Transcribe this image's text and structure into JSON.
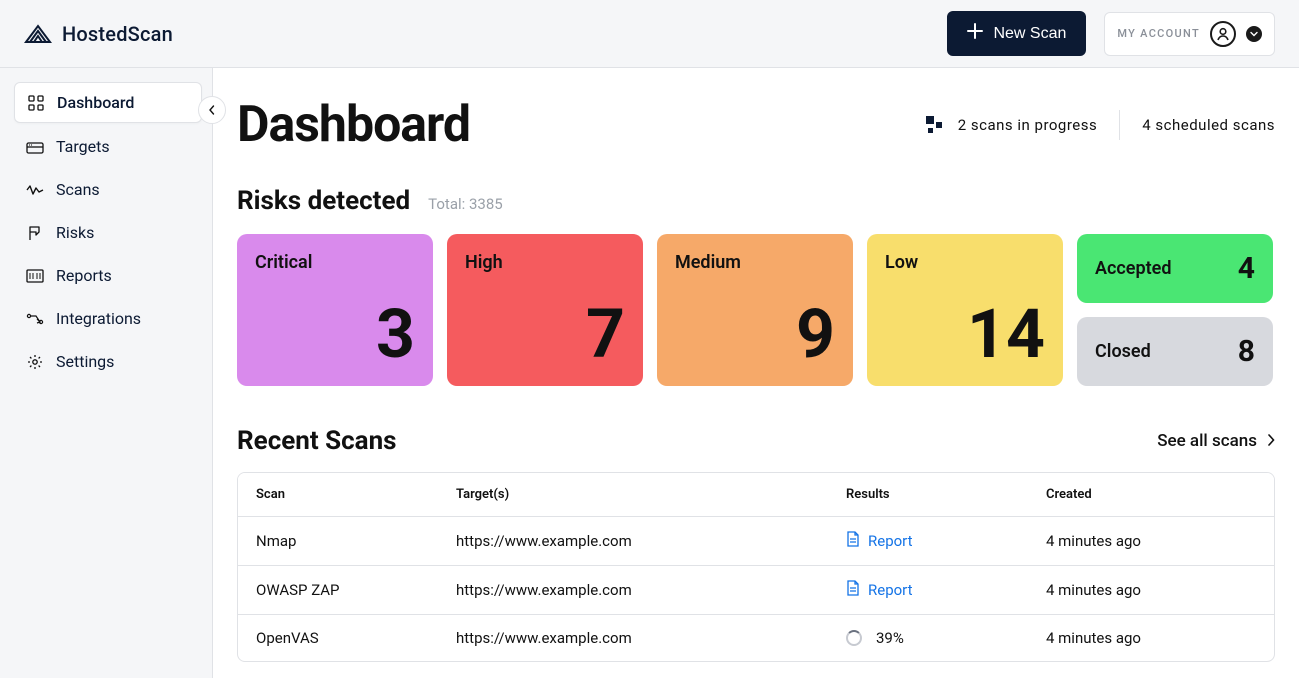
{
  "brand": {
    "name": "HostedScan"
  },
  "header": {
    "new_scan_label": "New Scan",
    "account_label": "MY ACCOUNT"
  },
  "sidebar": {
    "items": [
      {
        "label": "Dashboard",
        "icon": "dashboard-icon",
        "active": true
      },
      {
        "label": "Targets",
        "icon": "targets-icon"
      },
      {
        "label": "Scans",
        "icon": "scans-icon"
      },
      {
        "label": "Risks",
        "icon": "risks-icon"
      },
      {
        "label": "Reports",
        "icon": "reports-icon"
      },
      {
        "label": "Integrations",
        "icon": "integrations-icon"
      },
      {
        "label": "Settings",
        "icon": "settings-icon"
      }
    ]
  },
  "page": {
    "title": "Dashboard",
    "scans_in_progress": "2 scans in progress",
    "scheduled_scans": "4 scheduled scans"
  },
  "risks": {
    "section_title": "Risks detected",
    "total_label": "Total: 3385",
    "cards": {
      "critical": {
        "label": "Critical",
        "value": "3"
      },
      "high": {
        "label": "High",
        "value": "7"
      },
      "medium": {
        "label": "Medium",
        "value": "9"
      },
      "low": {
        "label": "Low",
        "value": "14"
      },
      "accepted": {
        "label": "Accepted",
        "value": "4"
      },
      "closed": {
        "label": "Closed",
        "value": "8"
      }
    }
  },
  "recent": {
    "section_title": "Recent Scans",
    "see_all_label": "See all scans",
    "headers": {
      "scan": "Scan",
      "targets": "Target(s)",
      "results": "Results",
      "created": "Created"
    },
    "report_label": "Report",
    "rows": [
      {
        "scan": "Nmap",
        "target": "https://www.example.com",
        "result_type": "report",
        "created": "4 minutes ago"
      },
      {
        "scan": "OWASP ZAP",
        "target": "https://www.example.com",
        "result_type": "report",
        "created": "4 minutes ago"
      },
      {
        "scan": "OpenVAS",
        "target": "https://www.example.com",
        "result_type": "progress",
        "progress": "39%",
        "created": "4 minutes ago"
      }
    ]
  }
}
